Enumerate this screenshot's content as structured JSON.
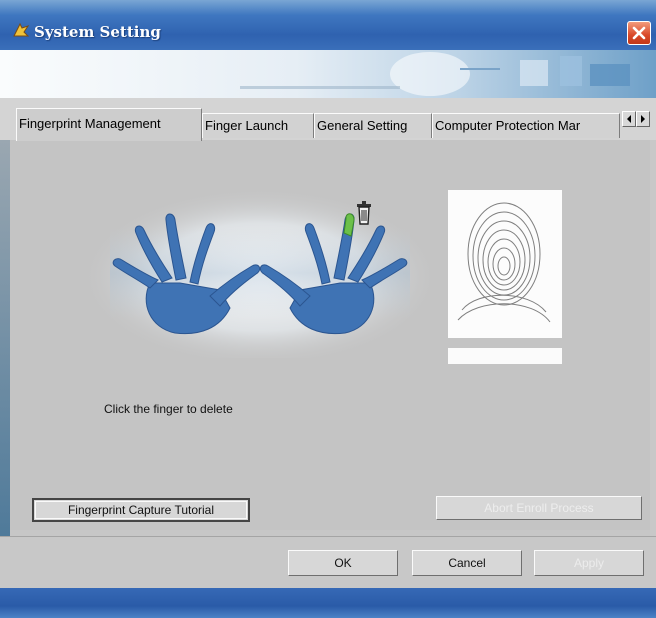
{
  "window": {
    "title": "System Setting"
  },
  "tabs": [
    {
      "label": "Fingerprint Management",
      "active": true
    },
    {
      "label": "Finger Launch",
      "active": false
    },
    {
      "label": "General Setting",
      "active": false
    },
    {
      "label": "Computer Protection Mar",
      "active": false
    }
  ],
  "icons": {
    "app": "app-icon",
    "close": "close-icon",
    "trash": "trash-icon",
    "scroll_left": "arrow-left-icon",
    "scroll_right": "arrow-right-icon"
  },
  "fingerprint": {
    "instruction": "Click the finger to delete",
    "selected_finger": "right-index",
    "finger_highlight_color": "#6cc04a"
  },
  "buttons": {
    "tutorial": "Fingerprint Capture Tutorial",
    "abort": "Abort Enroll Process",
    "ok": "OK",
    "cancel": "Cancel",
    "apply": "Apply"
  },
  "colors": {
    "titlebar": "#2f62b0",
    "hand": "#3f73b4",
    "panel": "#c4c4c4"
  }
}
